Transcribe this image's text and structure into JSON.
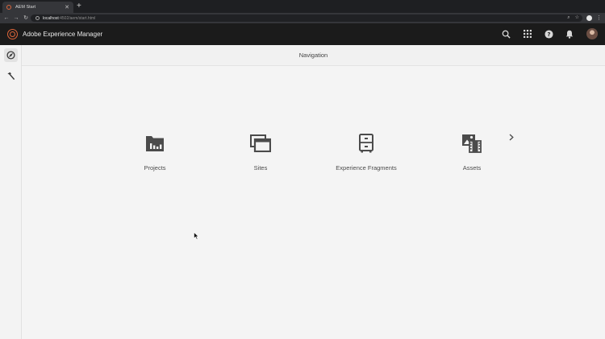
{
  "browser": {
    "tab_title": "AEM Start",
    "url_host": "localhost",
    "url_path": ":4502/aem/start.html"
  },
  "header": {
    "app_title": "Adobe Experience Manager",
    "icons": [
      "search-icon",
      "apps-grid-icon",
      "help-icon",
      "bell-icon",
      "user-avatar"
    ]
  },
  "rail": {
    "items": [
      "navigation-compass-icon",
      "tools-hammer-icon"
    ]
  },
  "main": {
    "title": "Navigation",
    "cards": [
      {
        "label": "Projects",
        "icon": "projects-icon"
      },
      {
        "label": "Sites",
        "icon": "sites-icon"
      },
      {
        "label": "Experience Fragments",
        "icon": "experience-fragments-icon"
      },
      {
        "label": "Assets",
        "icon": "assets-icon",
        "has_submenu": true
      }
    ]
  },
  "colors": {
    "brand_accent": "#e0663a",
    "header_bg": "#1b1b1b",
    "icon_gray": "#4b4b4b"
  }
}
